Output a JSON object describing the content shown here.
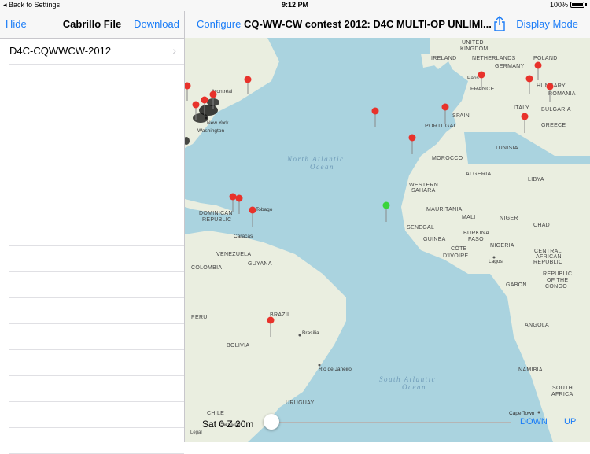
{
  "status": {
    "back_label": "Back to Settings",
    "time": "9:12 PM",
    "battery": "100%"
  },
  "sidebar": {
    "hide_label": "Hide",
    "title": "Cabrillo File",
    "download_label": "Download",
    "items": [
      {
        "label": "D4C-CQWWCW-2012"
      }
    ]
  },
  "main": {
    "configure_label": "Configure",
    "title": "CQ-WW-CW contest 2012: D4C MULTI-OP UNLIMI...",
    "share_icon": "share-icon",
    "display_mode_label": "Display Mode"
  },
  "map": {
    "legal": "Legal",
    "ocean_labels": [
      "North Atlantic",
      "Ocean",
      "South Atlantic",
      "Ocean"
    ],
    "countries": [
      "UNITED",
      "KINGDOM",
      "IRELAND",
      "NETHERLANDS",
      "GERMANY",
      "POLAND",
      "FRANCE",
      "HUNGARY",
      "ROMANIA",
      "ITALY",
      "BULGARIA",
      "SPAIN",
      "PORTUGAL",
      "GREECE",
      "TUNISIA",
      "MOROCCO",
      "ALGERIA",
      "LIBYA",
      "WESTERN",
      "SAHARA",
      "MAURITANIA",
      "MALI",
      "NIGER",
      "CHAD",
      "SENEGAL",
      "GUINEA",
      "BURKINA",
      "FASO",
      "CÔTE",
      "D'IVOIRE",
      "NIGERIA",
      "CENTRAL",
      "AFRICAN",
      "REPUBLIC",
      "GABON",
      "REPUBLIC",
      "OF THE",
      "CONGO",
      "ANGOLA",
      "NAMIBIA",
      "SOUTH",
      "AFRICA",
      "DOMINICAN",
      "REPUBLIC",
      "VENEZUELA",
      "COLOMBIA",
      "GUYANA",
      "PERU",
      "BRAZIL",
      "BOLIVIA",
      "CHILE",
      "URUGUAY"
    ],
    "cities": [
      "Paris",
      "Montréal",
      "New York",
      "Washington",
      "Caracas",
      "Lagos",
      "Brasília",
      "Rio de Janeiro",
      "Cape Town",
      "Santiago",
      "Tobago"
    ]
  },
  "timeline": {
    "time_text": "Sat 0 Z  20m",
    "down_label": "DOWN",
    "up_label": "UP"
  }
}
